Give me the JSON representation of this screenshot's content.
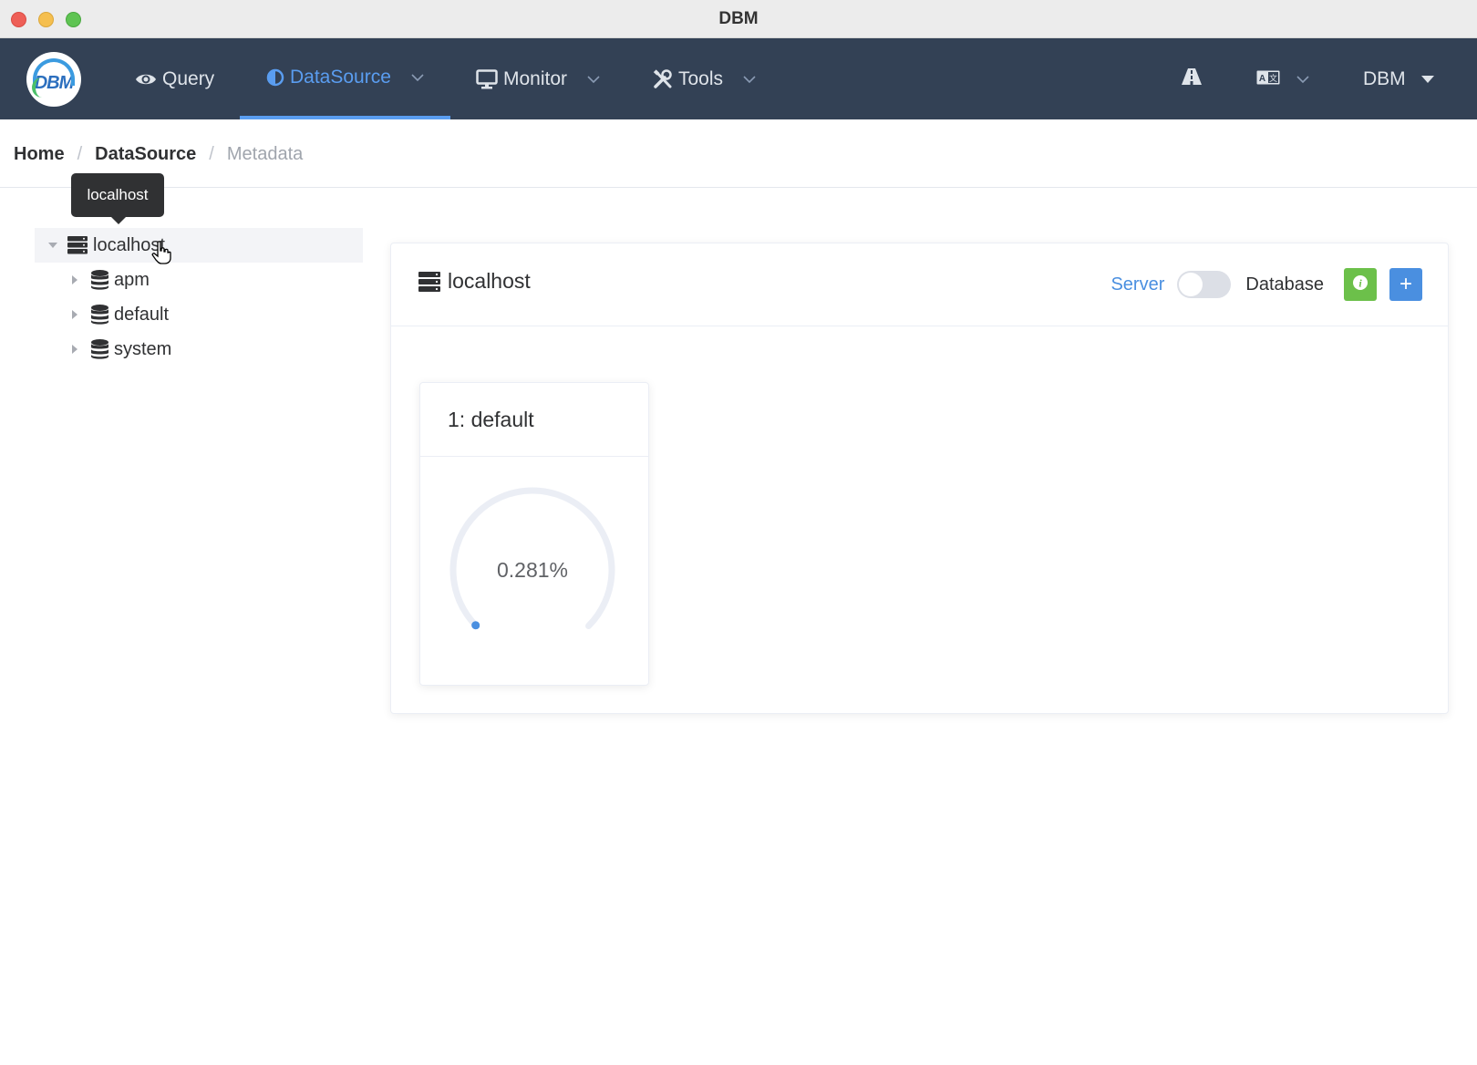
{
  "window": {
    "title": "DBM"
  },
  "nav": {
    "items": [
      {
        "label": "Query",
        "icon": "eye-icon"
      },
      {
        "label": "DataSource",
        "icon": "half-circle-icon",
        "active": true
      },
      {
        "label": "Monitor",
        "icon": "monitor-icon"
      },
      {
        "label": "Tools",
        "icon": "tools-icon"
      }
    ],
    "right": {
      "user_label": "DBM"
    }
  },
  "breadcrumb": [
    "Home",
    "DataSource",
    "Metadata"
  ],
  "tooltip": {
    "text": "localhost"
  },
  "tree": {
    "root": {
      "label": "localhost",
      "expanded": true,
      "icon": "server-icon"
    },
    "children": [
      {
        "label": "apm",
        "icon": "database-icon"
      },
      {
        "label": "default",
        "icon": "database-icon"
      },
      {
        "label": "system",
        "icon": "database-icon"
      }
    ]
  },
  "panel": {
    "title": "localhost",
    "server_label": "Server",
    "database_label": "Database",
    "switch_on": false,
    "add_label": "+"
  },
  "db_cards": [
    {
      "title": "1: default",
      "usage_text": "0.281%",
      "usage_fraction": 0.00281
    }
  ],
  "colors": {
    "nav_bg": "#334155",
    "accent": "#4a8fe0",
    "success": "#6cc04a"
  }
}
